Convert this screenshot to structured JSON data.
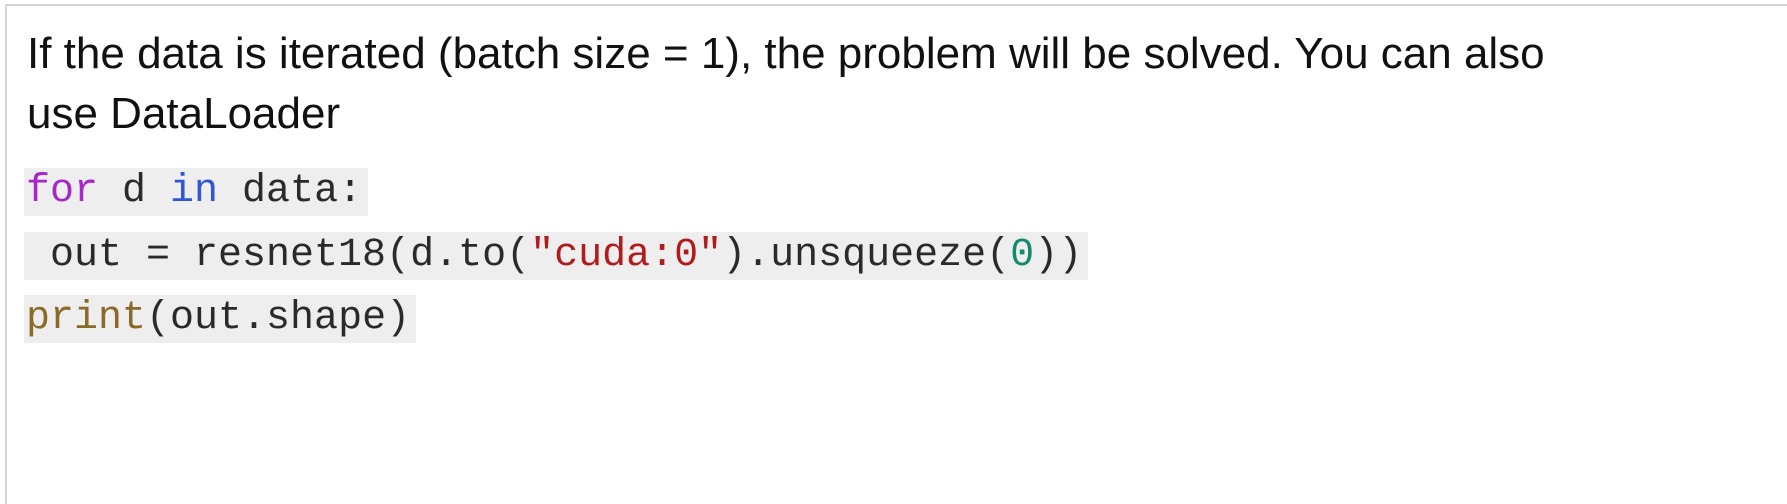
{
  "paragraph": {
    "line1": "If the data is iterated (batch size = 1), the problem will be solved. You can also",
    "line2": "use DataLoader"
  },
  "code": {
    "line1": {
      "kw_for": "for",
      "var_d": " d ",
      "kw_in": "in",
      "rest": " data:"
    },
    "line2": {
      "prefix": " out = resnet18(d.to(",
      "string": "\"cuda:0\"",
      "middle": ").unsqueeze(",
      "number": "0",
      "suffix": "))"
    },
    "line3": {
      "fn": "print",
      "rest": "(out.shape)"
    }
  },
  "colors": {
    "keyword_for": "#a626c8",
    "keyword_in": "#2f56d6",
    "builtin_print": "#8a6a26",
    "string": "#b01c1c",
    "number": "#128a6e",
    "code_background": "#eeeeee"
  }
}
